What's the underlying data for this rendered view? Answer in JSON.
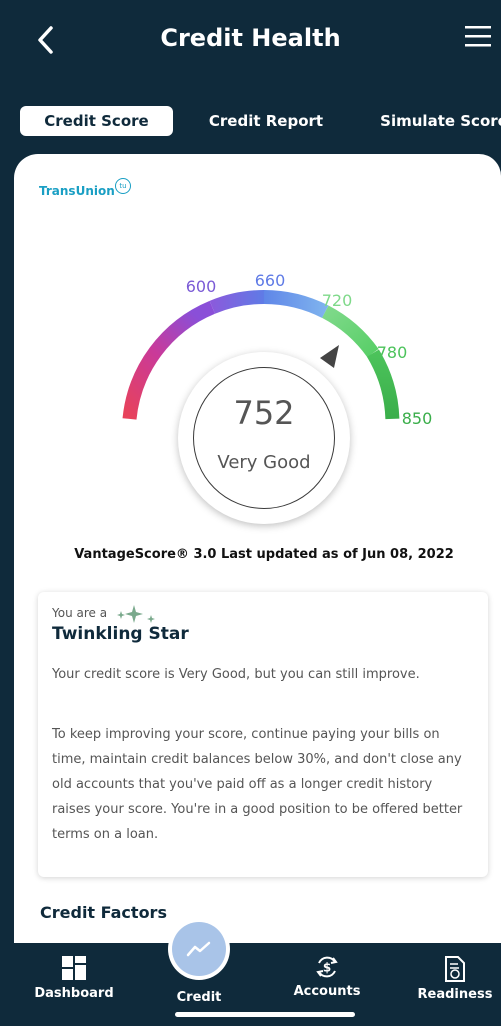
{
  "header": {
    "title": "Credit Health",
    "back_icon": "chevron-left-icon",
    "menu_icon": "hamburger-menu-icon"
  },
  "tabs": [
    {
      "label": "Credit Score",
      "active": true
    },
    {
      "label": "Credit Report",
      "active": false
    },
    {
      "label": "Simulate Score",
      "active": false
    }
  ],
  "bureau": {
    "name": "TransUnion",
    "badge": "tu"
  },
  "gauge": {
    "ticks": [
      "600",
      "660",
      "720",
      "780",
      "850"
    ],
    "score": "752",
    "rating": "Very Good",
    "score_value": 752,
    "min": 300,
    "max": 850
  },
  "updated_text": "VantageScore® 3.0 Last updated as of Jun 08, 2022",
  "card": {
    "pre": "You are a",
    "headline": "Twinkling Star",
    "p1": "Your credit score is Very Good, but you can still improve.",
    "p2": "To keep improving your score, continue paying your bills on time, maintain credit balances below 30%, and don't close any old accounts that you've paid off as a longer credit history raises your score. You're in a good position to be offered better terms on a loan."
  },
  "section_title": "Credit Factors",
  "nav": [
    {
      "label": "Dashboard",
      "icon": "dashboard-icon"
    },
    {
      "label": "Credit",
      "icon": "trend-icon"
    },
    {
      "label": "Accounts",
      "icon": "dollar-refresh-icon"
    },
    {
      "label": "Readiness",
      "icon": "document-check-icon"
    }
  ],
  "colors": {
    "navy": "#0f2a3b",
    "accent": "#a9c4e8"
  }
}
